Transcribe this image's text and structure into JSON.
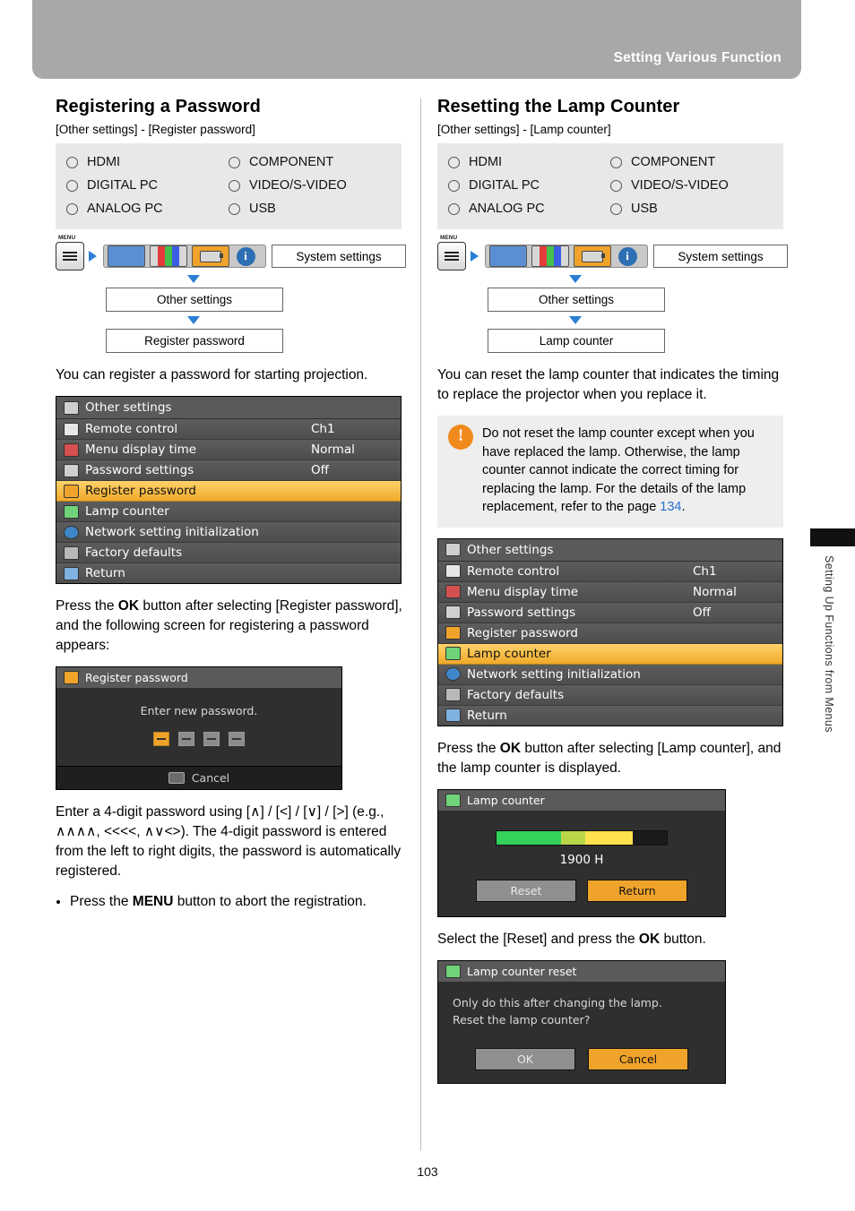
{
  "header": {
    "title": "Setting Various Function"
  },
  "page_number": "103",
  "side_tab_text": "Setting Up Functions from Menus",
  "inputs": {
    "left": [
      "HDMI",
      "DIGITAL PC",
      "ANALOG PC"
    ],
    "right": [
      "COMPONENT",
      "VIDEO/S-VIDEO",
      "USB"
    ]
  },
  "menu_widget": {
    "menu_label": "MENU",
    "system_settings": "System settings"
  },
  "left_column": {
    "title": "Registering a Password",
    "breadcrumb": "[Other settings] - [Register password]",
    "path_step1": "Other settings",
    "path_step2": "Register password",
    "intro": "You can register a password for starting projection.",
    "osd": {
      "title": "Other settings",
      "rows": [
        {
          "name": "Remote control",
          "value": "Ch1",
          "selected": false
        },
        {
          "name": "Menu display time",
          "value": "Normal",
          "selected": false
        },
        {
          "name": "Password settings",
          "value": "Off",
          "selected": false
        },
        {
          "name": "Register password",
          "value": "",
          "selected": true
        },
        {
          "name": "Lamp counter",
          "value": "",
          "selected": false
        },
        {
          "name": "Network setting initialization",
          "value": "",
          "selected": false
        },
        {
          "name": "Factory defaults",
          "value": "",
          "selected": false
        },
        {
          "name": "Return",
          "value": "",
          "selected": false
        }
      ]
    },
    "para2_pre": "Press the ",
    "para2_ok": "OK",
    "para2_post": " button after selecting [Register password], and the following screen for registering a password appears:",
    "register_osd": {
      "title": "Register password",
      "prompt": "Enter new password.",
      "cancel": "Cancel"
    },
    "para3": "Enter a 4-digit password using [∧] / [<] / [∨] / [>] (e.g., ∧∧∧∧, <<<<, ∧∨<>). The 4-digit password is entered from the left to right digits, the password is automatically registered.",
    "bullet_pre": "Press the ",
    "bullet_menu": "MENU",
    "bullet_post": " button to abort the registration."
  },
  "right_column": {
    "title": "Resetting the Lamp Counter",
    "breadcrumb": "[Other settings] - [Lamp counter]",
    "path_step1": "Other settings",
    "path_step2": "Lamp counter",
    "intro": "You can reset the lamp counter that indicates the timing to replace the projector when you replace it.",
    "note": {
      "text_pre": "Do not reset the lamp counter except when you have replaced the lamp. Otherwise, the lamp counter cannot indicate the correct timing for replacing the lamp. For the details of the lamp replacement, refer to the page ",
      "link": "134",
      "text_post": "."
    },
    "osd": {
      "title": "Other settings",
      "rows": [
        {
          "name": "Remote control",
          "value": "Ch1",
          "selected": false
        },
        {
          "name": "Menu display time",
          "value": "Normal",
          "selected": false
        },
        {
          "name": "Password settings",
          "value": "Off",
          "selected": false
        },
        {
          "name": "Register password",
          "value": "",
          "selected": false
        },
        {
          "name": "Lamp counter",
          "value": "",
          "selected": true
        },
        {
          "name": "Network setting initialization",
          "value": "",
          "selected": false
        },
        {
          "name": "Factory defaults",
          "value": "",
          "selected": false
        },
        {
          "name": "Return",
          "value": "",
          "selected": false
        }
      ]
    },
    "para2_pre": "Press the ",
    "para2_ok": "OK",
    "para2_post": " button after selecting [Lamp counter], and the lamp counter is displayed.",
    "lamp_osd": {
      "title": "Lamp counter",
      "hours": "1900 H",
      "reset_label": "Reset",
      "return_label": "Return"
    },
    "para3_pre": "Select the [Reset] and press the ",
    "para3_ok": "OK",
    "para3_post": " button.",
    "reset_osd": {
      "title": "Lamp counter reset",
      "line1": "Only do this after changing the lamp.",
      "line2": "Reset the lamp counter?",
      "ok_label": "OK",
      "cancel_label": "Cancel"
    }
  }
}
